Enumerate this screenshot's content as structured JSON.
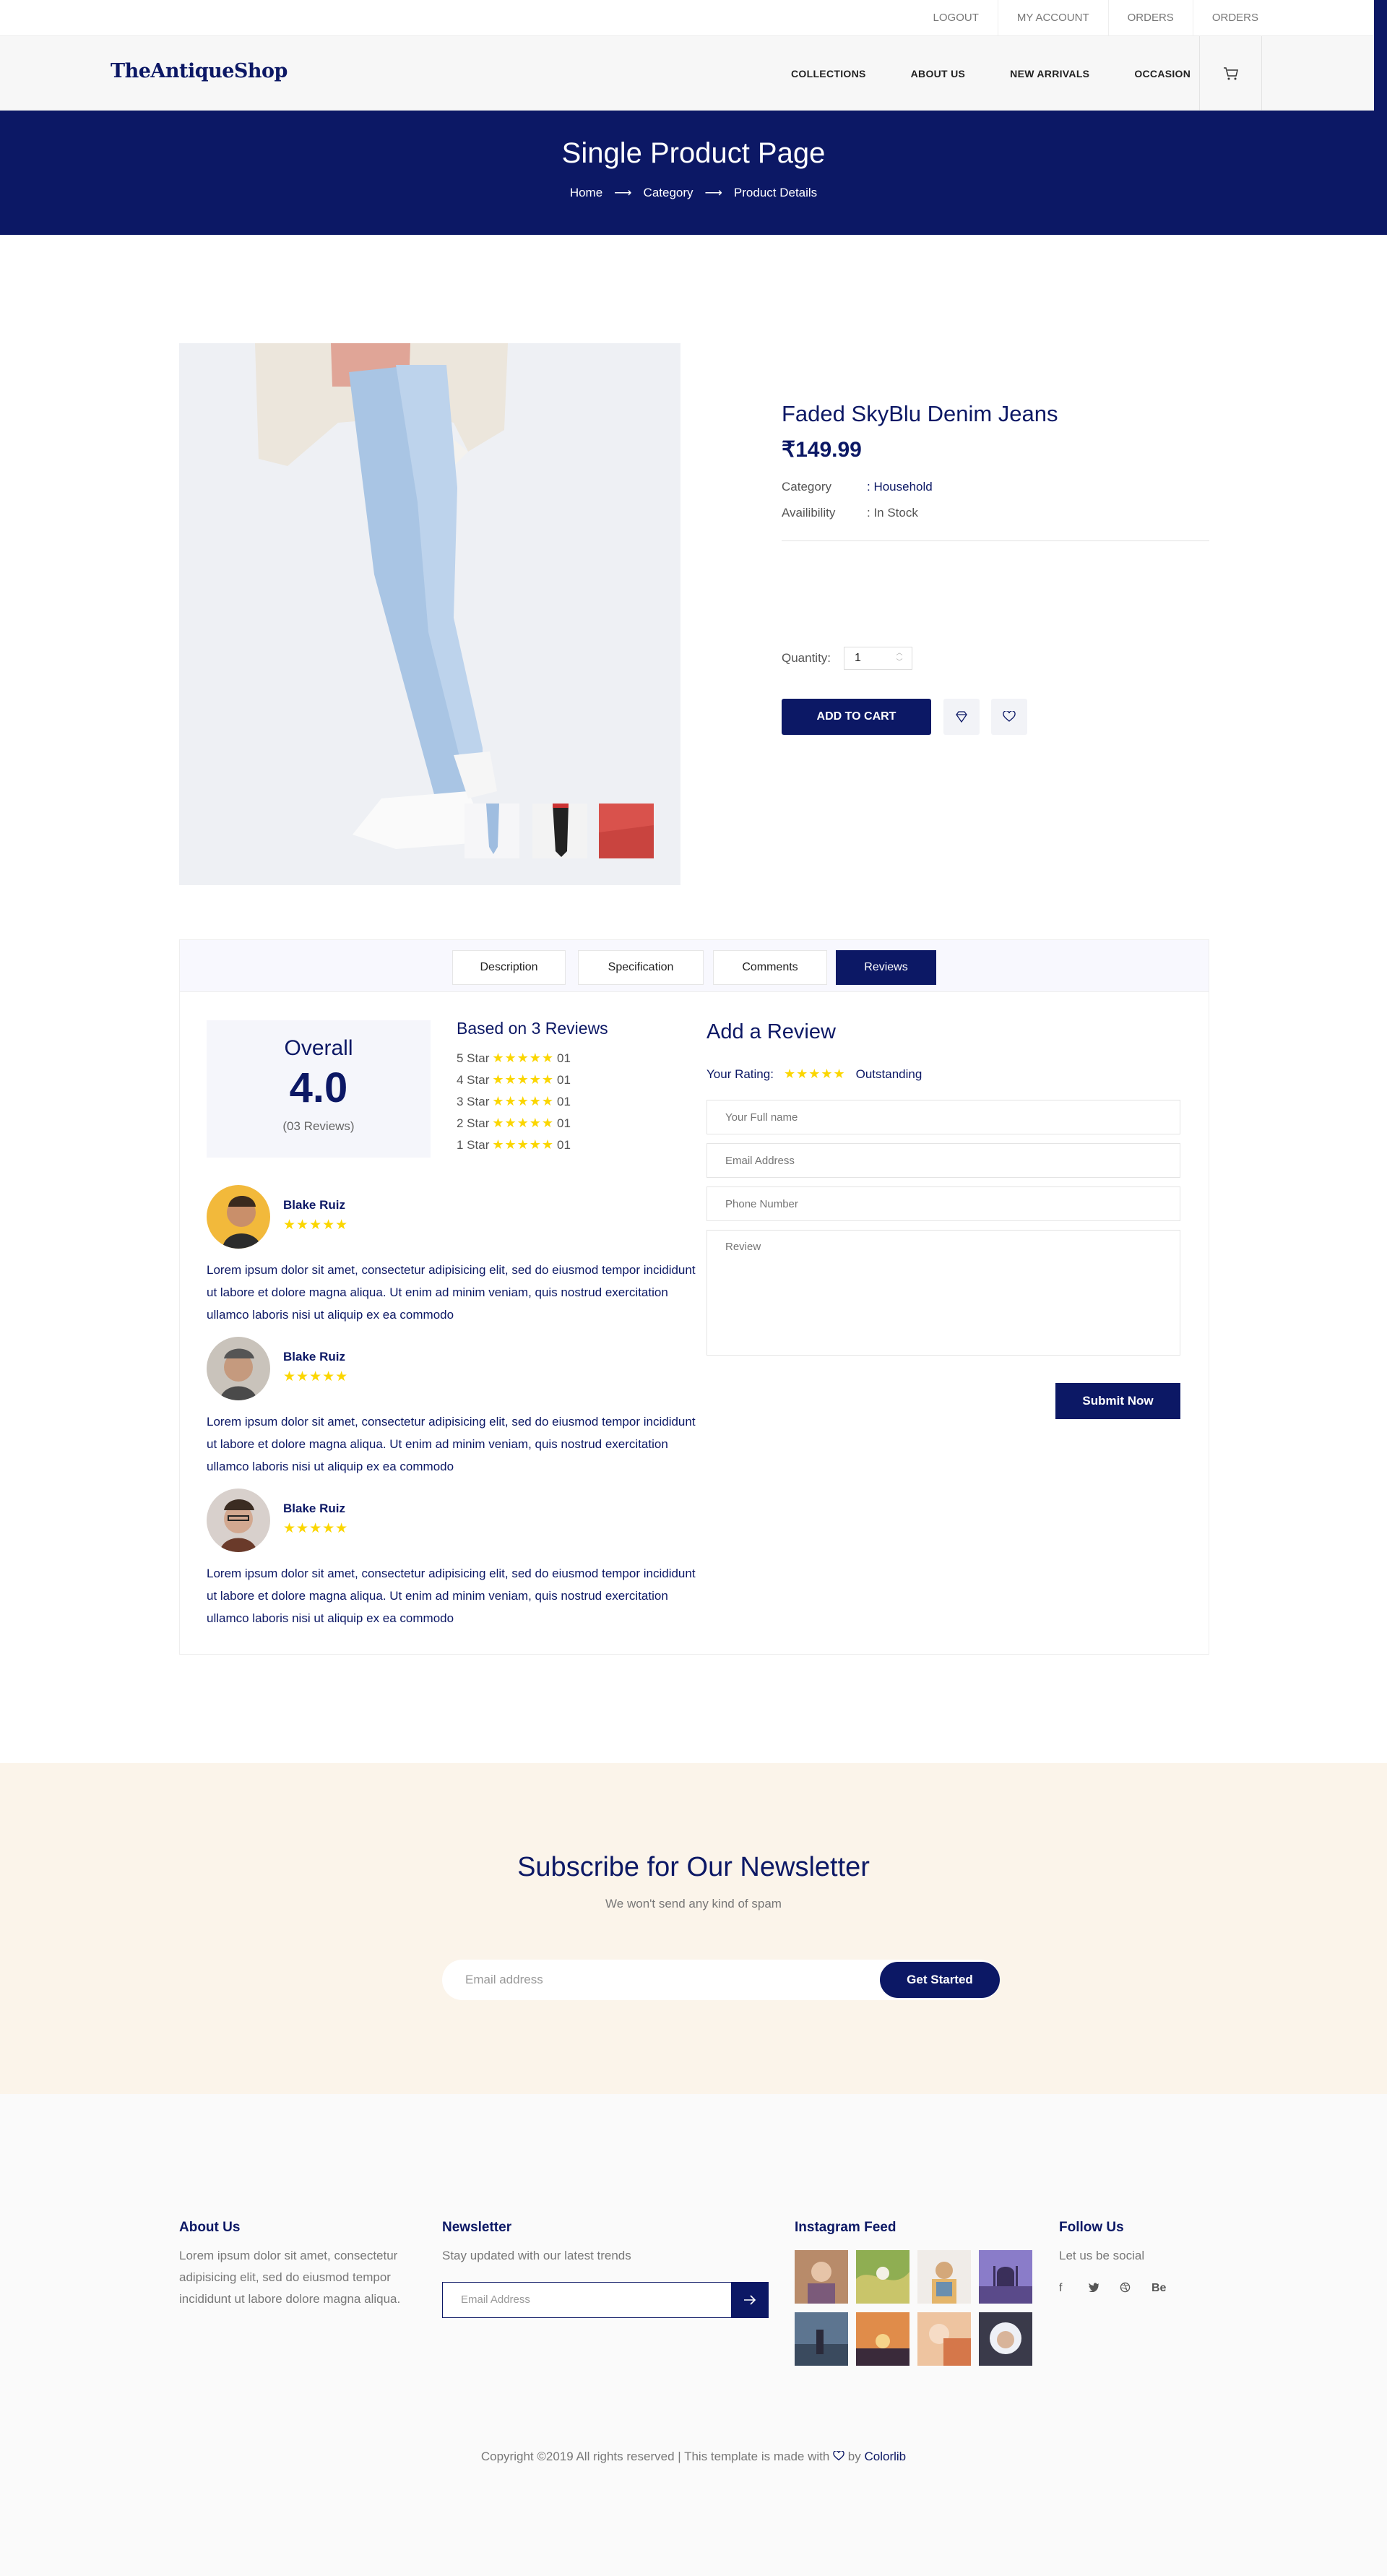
{
  "topbar": {
    "links": [
      "LOGOUT",
      "MY ACCOUNT",
      "ORDERS",
      "ORDERS"
    ]
  },
  "header": {
    "logo": "TheAntiqueShop",
    "nav": [
      "COLLECTIONS",
      "ABOUT US",
      "NEW ARRIVALS",
      "OCCASION"
    ],
    "cart_icon": "cart-icon"
  },
  "banner": {
    "title": "Single Product Page",
    "breadcrumb": [
      "Home",
      "Category",
      "Product Details"
    ]
  },
  "product": {
    "title": "Faded SkyBlu Denim Jeans",
    "price": "₹149.99",
    "category_label": "Category",
    "category_value": ": Household",
    "availability_label": "Availibility",
    "availability_value": ": In Stock",
    "quantity_label": "Quantity:",
    "quantity_value": "1",
    "add_to_cart": "ADD TO CART",
    "thumbnails": [
      "thumb-jeans-light",
      "thumb-jeans-dark",
      "thumb-red"
    ]
  },
  "tabs": [
    "Description",
    "Specification",
    "Comments",
    "Reviews"
  ],
  "active_tab": "Reviews",
  "reviews": {
    "overall_label": "Overall",
    "overall_score": "4.0",
    "overall_count": "(03 Reviews)",
    "based_on": "Based on 3 Reviews",
    "breakdown": [
      {
        "label": "5 Star",
        "count": "01"
      },
      {
        "label": "4 Star",
        "count": "01"
      },
      {
        "label": "3 Star",
        "count": "01"
      },
      {
        "label": "2 Star",
        "count": "01"
      },
      {
        "label": "1 Star",
        "count": "01"
      }
    ],
    "items": [
      {
        "name": "Blake Ruiz",
        "rating": 5,
        "text": "Lorem ipsum dolor sit amet, consectetur adipisicing elit, sed do eiusmod tempor incididunt ut labore et dolore magna aliqua. Ut enim ad minim veniam, quis nostrud exercitation ullamco laboris nisi ut aliquip ex ea commodo"
      },
      {
        "name": "Blake Ruiz",
        "rating": 5,
        "text": "Lorem ipsum dolor sit amet, consectetur adipisicing elit, sed do eiusmod tempor incididunt ut labore et dolore magna aliqua. Ut enim ad minim veniam, quis nostrud exercitation ullamco laboris nisi ut aliquip ex ea commodo"
      },
      {
        "name": "Blake Ruiz",
        "rating": 5,
        "text": "Lorem ipsum dolor sit amet, consectetur adipisicing elit, sed do eiusmod tempor incididunt ut labore et dolore magna aliqua. Ut enim ad minim veniam, quis nostrud exercitation ullamco laboris nisi ut aliquip ex ea commodo"
      }
    ]
  },
  "add_review": {
    "title": "Add a Review",
    "rating_label": "Your Rating:",
    "rating_value": 5,
    "rating_text": "Outstanding",
    "name_placeholder": "Your Full name",
    "email_placeholder": "Email Address",
    "phone_placeholder": "Phone Number",
    "review_placeholder": "Review",
    "submit": "Submit Now"
  },
  "newsletter": {
    "title": "Subscribe for Our Newsletter",
    "subtitle": "We won't send any kind of spam",
    "placeholder": "Email address",
    "button": "Get Started"
  },
  "footer": {
    "about_title": "About Us",
    "about_text": "Lorem ipsum dolor sit amet, consectetur adipisicing elit, sed do eiusmod tempor incididunt ut labore dolore magna aliqua.",
    "newsletter_title": "Newsletter",
    "newsletter_text": "Stay updated with our latest trends",
    "newsletter_placeholder": "Email Address",
    "instagram_title": "Instagram Feed",
    "follow_title": "Follow Us",
    "follow_text": "Let us be social",
    "social": [
      "f",
      "t",
      "dribbble-icon",
      "Be"
    ],
    "copyright_prefix": "Copyright ©2019 All rights reserved | This template is made with",
    "copyright_by": "by",
    "copyright_link": "Colorlib"
  },
  "colors": {
    "primary": "#0c1865",
    "star": "#fbd600",
    "newsletter_bg": "#fbf4ea"
  }
}
